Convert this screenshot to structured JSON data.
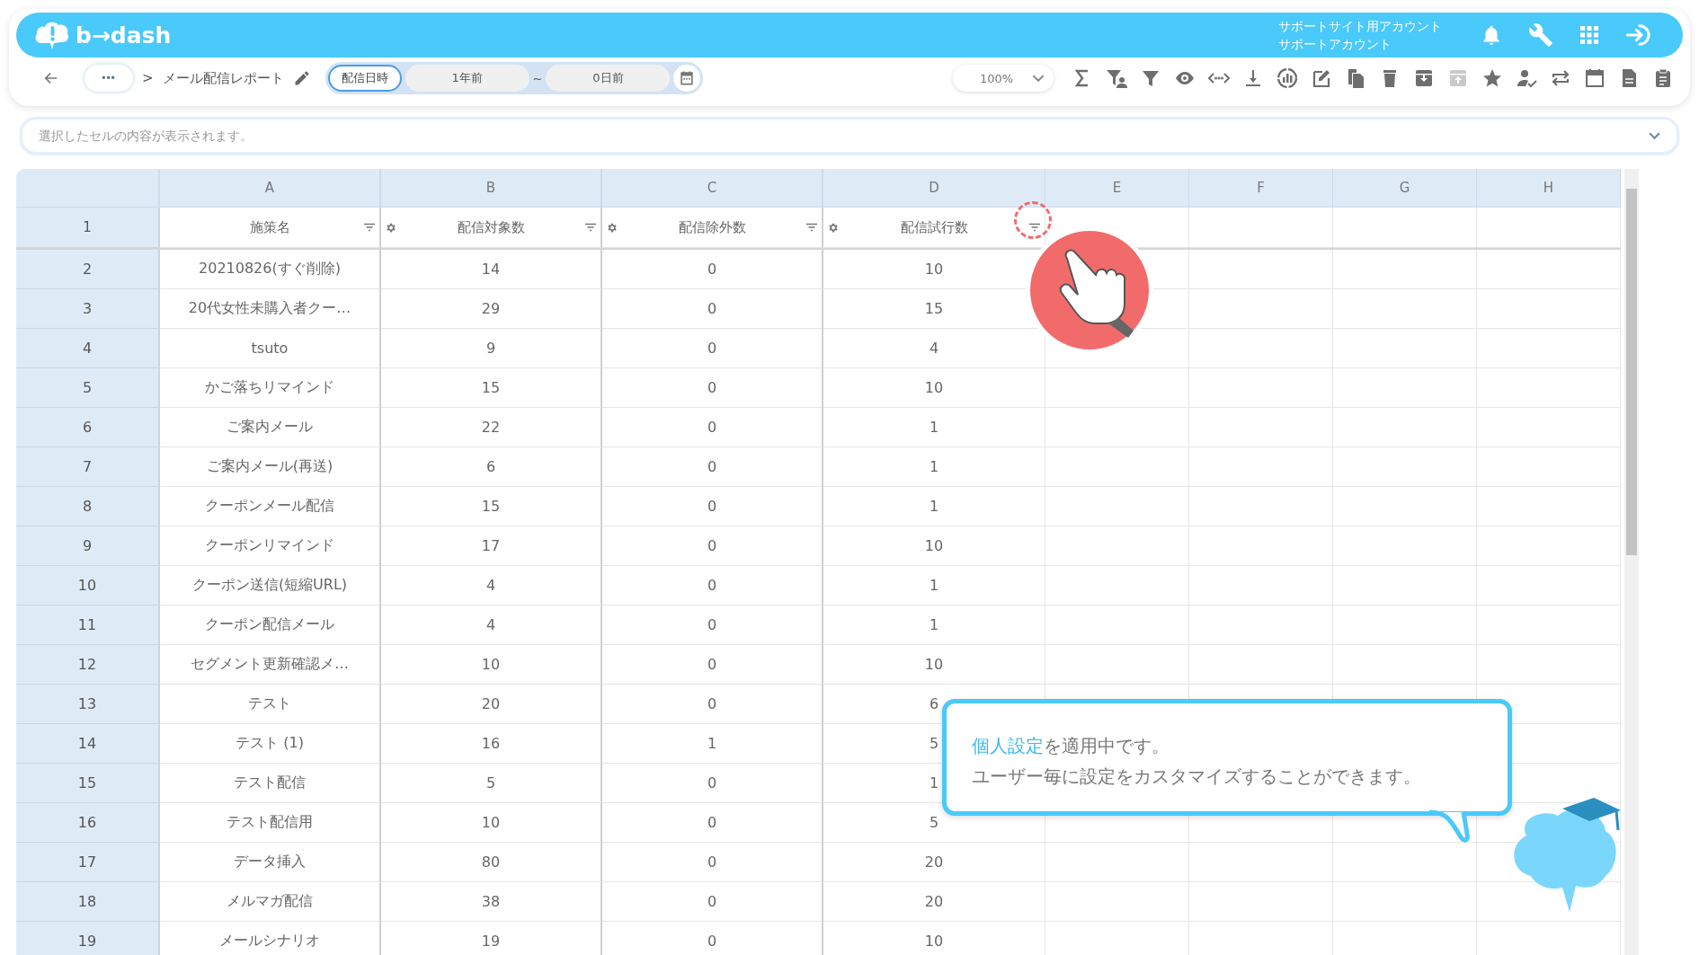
{
  "header": {
    "logo": "b→dash",
    "account_line1": "サポートサイト用アカウント",
    "account_line2": "サポートアカウント"
  },
  "breadcrumb": {
    "more": "•••",
    "separator": ">",
    "title": "メール配信レポート"
  },
  "date_filter": {
    "label": "配信日時",
    "from": "1年前",
    "tilde": "~",
    "to": "0日前"
  },
  "zoom": {
    "value": "100%"
  },
  "toolbar": [
    {
      "kind": "sum",
      "disabled": false
    },
    {
      "kind": "user-filter",
      "disabled": false
    },
    {
      "kind": "filter",
      "disabled": false
    },
    {
      "kind": "eye",
      "disabled": false
    },
    {
      "kind": "code",
      "disabled": false
    },
    {
      "kind": "download",
      "disabled": false
    },
    {
      "kind": "chart",
      "disabled": false
    },
    {
      "kind": "edit",
      "disabled": false
    },
    {
      "kind": "copy",
      "disabled": false
    },
    {
      "kind": "trash",
      "disabled": false
    },
    {
      "kind": "archive",
      "disabled": false
    },
    {
      "kind": "unarchive",
      "disabled": true
    },
    {
      "kind": "star",
      "disabled": false
    },
    {
      "kind": "user-check",
      "disabled": false
    },
    {
      "kind": "swap",
      "disabled": false
    },
    {
      "kind": "calendar",
      "disabled": false
    },
    {
      "kind": "document",
      "disabled": false
    },
    {
      "kind": "clipboard",
      "disabled": false
    }
  ],
  "cell_bar": {
    "placeholder": "選択したセルの内容が表示されます。"
  },
  "sheet": {
    "columns": [
      "A",
      "B",
      "C",
      "D",
      "E",
      "F",
      "G",
      "H"
    ],
    "header_row": {
      "number": "1",
      "cells": [
        "施策名",
        "配信対象数",
        "配信除外数",
        "配信試行数"
      ]
    },
    "rows": [
      {
        "number": "2",
        "cells": [
          "20210826(すぐ削除)",
          "14",
          "0",
          "10"
        ]
      },
      {
        "number": "3",
        "cells": [
          "20代女性未購入者クー…",
          "29",
          "0",
          "15"
        ]
      },
      {
        "number": "4",
        "cells": [
          "tsuto",
          "9",
          "0",
          "4"
        ]
      },
      {
        "number": "5",
        "cells": [
          "かご落ちリマインド",
          "15",
          "0",
          "10"
        ]
      },
      {
        "number": "6",
        "cells": [
          "ご案内メール",
          "22",
          "0",
          "1"
        ]
      },
      {
        "number": "7",
        "cells": [
          "ご案内メール(再送)",
          "6",
          "0",
          "1"
        ]
      },
      {
        "number": "8",
        "cells": [
          "クーポンメール配信",
          "15",
          "0",
          "1"
        ]
      },
      {
        "number": "9",
        "cells": [
          "クーポンリマインド",
          "17",
          "0",
          "10"
        ]
      },
      {
        "number": "10",
        "cells": [
          "クーポン送信(短縮URL)",
          "4",
          "0",
          "1"
        ]
      },
      {
        "number": "11",
        "cells": [
          "クーポン配信メール",
          "4",
          "0",
          "1"
        ]
      },
      {
        "number": "12",
        "cells": [
          "セグメント更新確認メ…",
          "10",
          "0",
          "10"
        ]
      },
      {
        "number": "13",
        "cells": [
          "テスト",
          "20",
          "0",
          "6"
        ]
      },
      {
        "number": "14",
        "cells": [
          "テスト (1)",
          "16",
          "1",
          "5"
        ]
      },
      {
        "number": "15",
        "cells": [
          "テスト配信",
          "5",
          "0",
          "1"
        ]
      },
      {
        "number": "16",
        "cells": [
          "テスト配信用",
          "10",
          "0",
          "5"
        ]
      },
      {
        "number": "17",
        "cells": [
          "データ挿入",
          "80",
          "0",
          "20"
        ]
      },
      {
        "number": "18",
        "cells": [
          "メルマガ配信",
          "38",
          "0",
          "20"
        ]
      },
      {
        "number": "19",
        "cells": [
          "メールシナリオ",
          "19",
          "0",
          "10"
        ]
      }
    ]
  },
  "tooltip": {
    "link": "個人設定",
    "line1": "を適用中です。",
    "line2": "ユーザー毎に設定をカスタマイズすることができます。"
  }
}
